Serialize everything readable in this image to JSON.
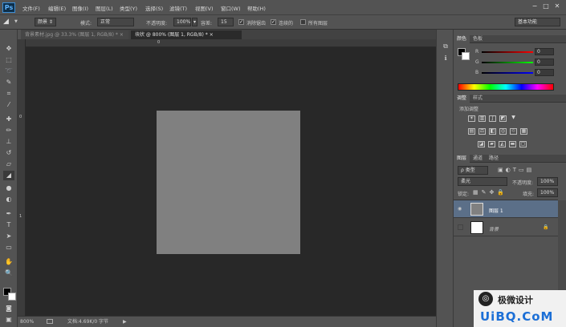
{
  "app": {
    "logo": "Ps"
  },
  "menu": [
    "文件(F)",
    "编辑(E)",
    "图像(I)",
    "图层(L)",
    "类型(Y)",
    "选择(S)",
    "滤镜(T)",
    "视图(V)",
    "窗口(W)",
    "帮助(H)"
  ],
  "window_controls": {
    "minimize": "−",
    "restore": "□",
    "close": "✕"
  },
  "options": {
    "preset": "颜景",
    "mode_label": "模式:",
    "mode_value": "正常",
    "opacity_label": "不透明度:",
    "opacity_value": "100%",
    "tolerance_label": "容差:",
    "tolerance_value": "15",
    "anti_alias_label": "消除锯齿",
    "anti_alias_checked": "✓",
    "contiguous_label": "连续的",
    "contiguous_checked": "✓",
    "all_layers_label": "所有图层",
    "workspace": "基本功能"
  },
  "tabs": [
    {
      "label": "背景素材.jpg @ 33.3% (图层 1, RGB/8) *",
      "close": "×"
    },
    {
      "label": "块状 @ 800% (图层 1, RGB/8) *",
      "close": "×"
    }
  ],
  "rulers": {
    "top_0": "0",
    "left_0": "0",
    "left_1": "1"
  },
  "status": {
    "zoom": "800%",
    "doc": "文档:4.69K/0 字节",
    "arrow": "▶"
  },
  "color_panel": {
    "tabs": [
      "颜色",
      "色板"
    ],
    "r_label": "R",
    "r_value": "0",
    "g_label": "G",
    "g_value": "0",
    "b_label": "B",
    "b_value": "0"
  },
  "adjust_panel": {
    "tabs": [
      "调整",
      "样式"
    ],
    "title": "添加调整"
  },
  "layers_panel": {
    "tabs": [
      "图层",
      "通道",
      "路径"
    ],
    "filter_kind": "ρ 类型",
    "blend_mode": "柔光",
    "opacity_label": "不透明度:",
    "opacity_value": "100%",
    "lock_label": "锁定:",
    "fill_label": "填充:",
    "fill_value": "100%",
    "layers": [
      {
        "name": "图层 1",
        "visible_icon": "👁"
      },
      {
        "name": "背景",
        "lock": "🔒"
      }
    ]
  },
  "watermark": {
    "brand": "极微设计",
    "site": "UiBQ.CoM"
  },
  "colors": {
    "canvas_bg": "#282828",
    "document_fill": "#808080",
    "selected_layer": "#5b6f88"
  }
}
